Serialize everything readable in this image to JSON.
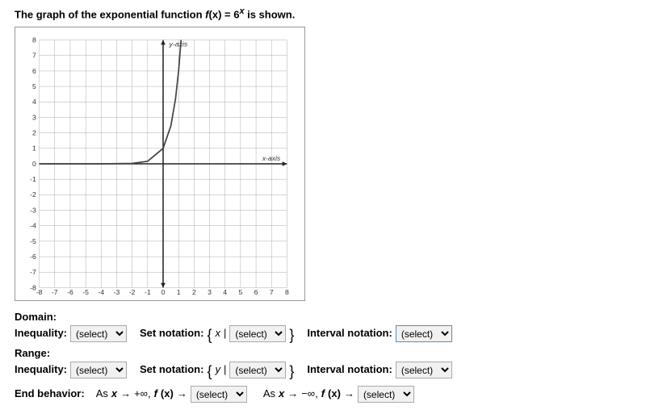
{
  "prompt_prefix": "The graph of the exponential function ",
  "prompt_fname": "f",
  "prompt_fargs": "(x) = 6",
  "prompt_exp": "x",
  "prompt_suffix": " is shown.",
  "y_axis_label": "y-axis",
  "x_axis_label": "x-axis",
  "domain_title": "Domain:",
  "range_title": "Range:",
  "inequality_label": "Inequality:",
  "setnotation_label": "Set notation:",
  "intervalnotation_label": "Interval notation:",
  "endbehavior_label": "End behavior:",
  "set_var_x": "x",
  "set_var_y": "y",
  "set_bar": "|",
  "end_as": "As ",
  "end_xvar": "x",
  "end_arrow": " → ",
  "end_posinf": "+∞, ",
  "end_neginf": "−∞, ",
  "end_f": "f",
  "end_fx": "(x)",
  "end_arrow2": " → ",
  "select_placeholder": "(select)",
  "chart_data": {
    "type": "line",
    "title": "f(x) = 6^x",
    "xlabel": "x-axis",
    "ylabel": "y-axis",
    "xlim": [
      -8,
      8
    ],
    "ylim": [
      -8,
      8
    ],
    "x_ticks": [
      -8,
      -7,
      -6,
      -5,
      -4,
      -3,
      -2,
      -1,
      0,
      1,
      2,
      3,
      4,
      5,
      6,
      7,
      8
    ],
    "y_ticks": [
      -8,
      -7,
      -6,
      -5,
      -4,
      -3,
      -2,
      -1,
      0,
      1,
      2,
      3,
      4,
      5,
      6,
      7,
      8
    ],
    "series": [
      {
        "name": "6^x",
        "x": [
          -8,
          -6,
          -4,
          -2,
          -1,
          0,
          0.5,
          0.8,
          1,
          1.16
        ],
        "y": [
          0.0,
          0.0,
          0.0008,
          0.0278,
          0.1667,
          1,
          2.449,
          4.193,
          6,
          8
        ]
      }
    ]
  }
}
